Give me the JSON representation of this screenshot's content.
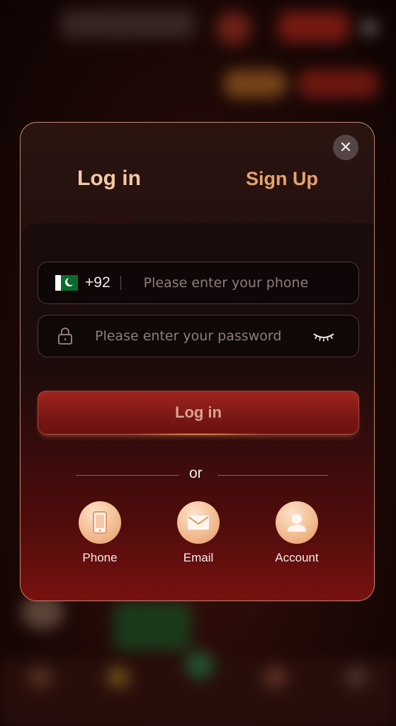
{
  "modal": {
    "close_symbol": "✕",
    "tabs": {
      "login": "Log in",
      "signup": "Sign Up"
    },
    "phone": {
      "country_code": "+92",
      "placeholder": "Please enter your phone",
      "flag_icon": "pakistan-flag-icon"
    },
    "password": {
      "placeholder": "Please enter your password",
      "lock_icon": "lock-icon",
      "toggle_icon": "eye-closed-icon"
    },
    "submit_label": "Log in",
    "divider_text": "or",
    "alt_methods": [
      {
        "label": "Phone",
        "icon": "phone-icon"
      },
      {
        "label": "Email",
        "icon": "email-icon"
      },
      {
        "label": "Account",
        "icon": "user-icon"
      }
    ]
  },
  "colors": {
    "accent": "#e2a46a",
    "button_red": "#8a1c18",
    "icon_circle": "#f1b88c"
  }
}
